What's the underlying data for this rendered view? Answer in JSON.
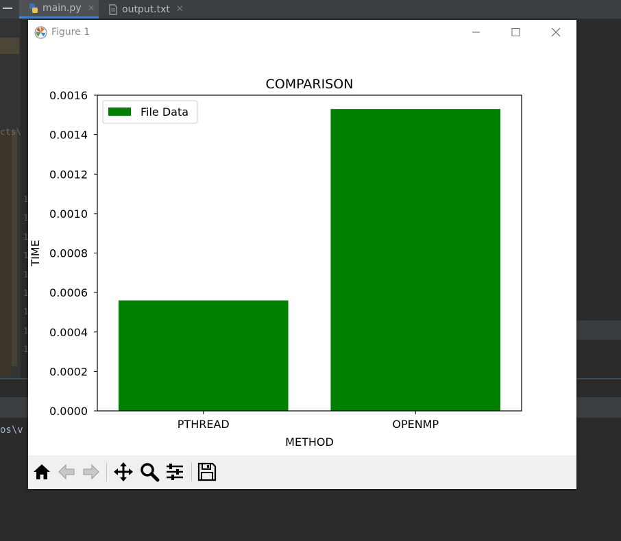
{
  "ide": {
    "tabs": [
      {
        "label": "main.py",
        "close": "✕"
      },
      {
        "label": "output.txt",
        "close": "✕"
      }
    ],
    "breadcrumb_fragment": "cts\\",
    "line_numbers": [
      "1",
      "1",
      "1",
      "1",
      "1",
      "1",
      "1",
      "1",
      "1"
    ],
    "console_fragment": "os\\v"
  },
  "figure": {
    "window_title": "Figure 1",
    "controls": {
      "minimize": "minimize-icon",
      "maximize": "maximize-icon",
      "close": "close-icon"
    },
    "toolbar": [
      {
        "name": "home-button",
        "icon": "home-icon"
      },
      {
        "name": "back-button",
        "icon": "back-arrow-icon"
      },
      {
        "name": "forward-button",
        "icon": "forward-arrow-icon"
      },
      {
        "name": "pan-button",
        "icon": "move-icon"
      },
      {
        "name": "zoom-button",
        "icon": "magnifier-icon"
      },
      {
        "name": "configure-subplots-button",
        "icon": "sliders-icon"
      },
      {
        "name": "save-button",
        "icon": "floppy-disk-icon"
      }
    ]
  },
  "chart_data": {
    "type": "bar",
    "title": "COMPARISON",
    "xlabel": "METHOD",
    "ylabel": "TIME",
    "categories": [
      "PTHREAD",
      "OPENMP"
    ],
    "series": [
      {
        "name": "File Data",
        "values": [
          0.00056,
          0.00153
        ],
        "color": "#008000"
      }
    ],
    "ylim": [
      0,
      0.0016
    ],
    "yticks": [
      "0.0000",
      "0.0002",
      "0.0004",
      "0.0006",
      "0.0008",
      "0.0010",
      "0.0012",
      "0.0014",
      "0.0016"
    ],
    "legend_position": "top-left",
    "grid": false
  }
}
